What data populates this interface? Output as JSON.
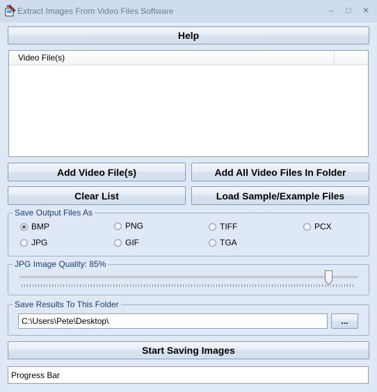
{
  "window": {
    "title": "Extract Images From Video Files Software",
    "minimize_glyph": "–",
    "maximize_glyph": "□",
    "close_glyph": "✕"
  },
  "help_label": "Help",
  "file_list": {
    "column_header": "Video File(s)",
    "items": []
  },
  "buttons": {
    "add_video_files": "Add Video File(s)",
    "add_all_in_folder": "Add All Video Files In Folder",
    "clear_list": "Clear List",
    "load_sample": "Load Sample/Example Files",
    "browse": "...",
    "start_saving": "Start Saving Images"
  },
  "output_format": {
    "label": "Save Output Files As",
    "selected": "BMP",
    "options": [
      "BMP",
      "PNG",
      "TIFF",
      "PCX",
      "JPG",
      "GIF",
      "TGA"
    ]
  },
  "jpg_quality": {
    "label": "JPG Image Quality: 85%",
    "value_percent": 85
  },
  "save_folder": {
    "label": "Save Results To This Folder",
    "path": "C:\\Users\\Pete\\Desktop\\"
  },
  "progress": {
    "label": "Progress Bar"
  },
  "colors": {
    "window_frame": "#cfdcee",
    "client_background": "#dfe9f5",
    "group_label_text": "#1a3d7a"
  }
}
